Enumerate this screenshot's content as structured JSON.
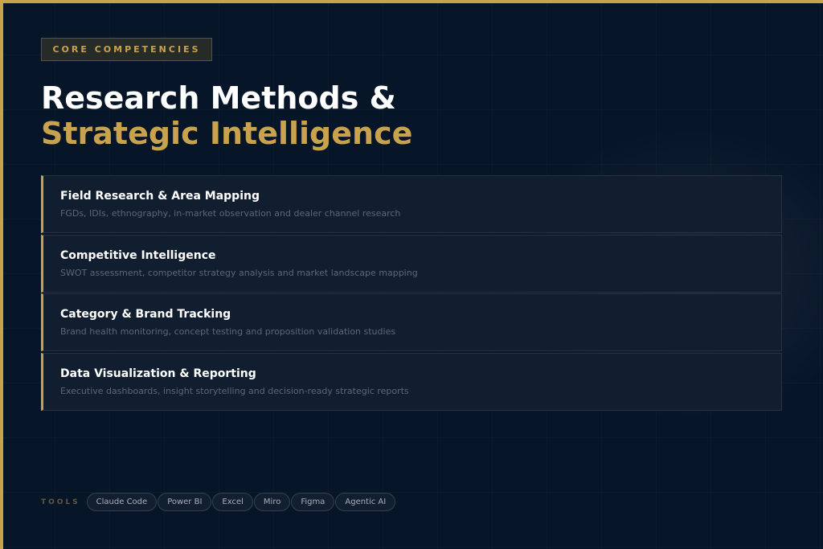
{
  "badge": {
    "label": "CORE COMPETENCIES"
  },
  "title": {
    "line1": "Research Methods &",
    "line2": "Strategic Intelligence"
  },
  "competencies": [
    {
      "title": "Field Research & Area Mapping",
      "description": "FGDs, IDIs, ethnography, in-market observation and dealer channel research"
    },
    {
      "title": "Competitive Intelligence",
      "description": "SWOT assessment, competitor strategy analysis and market landscape mapping"
    },
    {
      "title": "Category & Brand Tracking",
      "description": "Brand health monitoring, concept testing and proposition validation studies"
    },
    {
      "title": "Data Visualization & Reporting",
      "description": "Executive dashboards, insight storytelling and decision-ready strategic reports"
    }
  ],
  "tools": {
    "label": "TOOLS",
    "items": [
      "Claude Code",
      "Power BI",
      "Excel",
      "Miro",
      "Figma",
      "Agentic AI"
    ]
  },
  "colors": {
    "accent": "#c9a24e",
    "background": "#071529",
    "card": "#111e2f"
  }
}
